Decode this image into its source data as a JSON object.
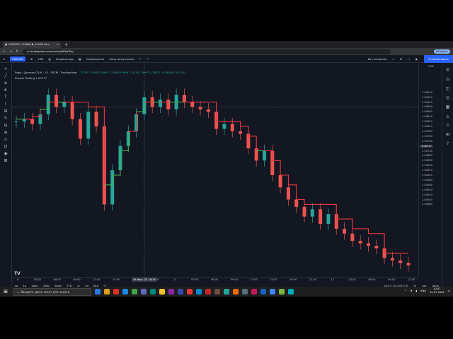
{
  "browser": {
    "tab_title": "EURUSD 1.00846 ▼ -0.56% Без...",
    "new_tab": "+",
    "url": "ru.tradingview.com/chart/pbE9oHPq/",
    "renew_label": "Обновить"
  },
  "tv_toolbar": {
    "symbol": "EURUSD",
    "timeframe": "15М",
    "indicators": "Индикаторы",
    "alerts": "Оповещения",
    "replay": "Симулятор рынка",
    "unnamed": "Без названия",
    "publish": "Опубликовать"
  },
  "legend": {
    "title": "Евро / Доллар США · 15 · FXCM · TradingView",
    "ohlc": "ОТКР 1.00822 МАКС 1.00859 МИН 1.00767 ЗАКР 1.00817 -0.00009 (-0.01%)",
    "indicator": "Simple Trading 1.00717"
  },
  "chart_data": {
    "type": "line",
    "title": "Евро / Доллар США · 15 · FXCM · TradingView",
    "ylim": [
      1.002,
      1.01
    ],
    "price_ticks": [
      "1.00940",
      "1.00920",
      "1.00900",
      "1.00880",
      "1.00860",
      "1.00840",
      "1.00820",
      "1.00800",
      "1.00780",
      "1.00760",
      "1.00740",
      "1.00720",
      "1.00700",
      "1.00680",
      "1.00660",
      "1.00640",
      "1.00620",
      "1.00600",
      "1.00580",
      "1.00560",
      "1.00540",
      "1.00520",
      "1.00500",
      "1.00480"
    ],
    "current_price": "1.00717",
    "currency": "USD",
    "time_ticks": [
      "8",
      "03:00",
      "06:00",
      "09:00",
      "12:00",
      "15:00",
      "18:00",
      "21:00",
      "11",
      "03:00",
      "06:00",
      "09:00",
      "12:00",
      "15:00",
      "18:00",
      "21:00",
      "12",
      "03:00",
      "06:00",
      "09:00",
      "12:00"
    ],
    "crosshair_time": "08 Июл '22   18:30",
    "series": [
      {
        "name": "Price",
        "values": [
          1.0082,
          1.0083,
          1.0081,
          1.0085,
          1.0093,
          1.0088,
          1.009,
          1.0083,
          1.0075,
          1.0086,
          1.008,
          1.0048,
          1.0062,
          1.0072,
          1.0078,
          1.0085,
          1.0092,
          1.0088,
          1.0091,
          1.0087,
          1.0093,
          1.009,
          1.0088,
          1.0087,
          1.0086,
          1.0079,
          1.0081,
          1.0078,
          1.0077,
          1.0071,
          1.0066,
          1.007,
          1.006,
          1.0055,
          1.005,
          1.0047,
          1.0043,
          1.0046,
          1.004,
          1.0044,
          1.0038,
          1.0036,
          1.0033,
          1.0032,
          1.0031,
          1.003,
          1.0026,
          1.0025,
          1.0024,
          1.0023
        ]
      },
      {
        "name": "Trend",
        "values": [
          1.0083,
          1.0083,
          1.0084,
          1.0087,
          1.009,
          1.009,
          1.009,
          1.009,
          1.009,
          1.0088,
          1.0088,
          1.0056,
          1.006,
          1.007,
          1.0078,
          1.0086,
          1.009,
          1.009,
          1.009,
          1.009,
          1.009,
          1.009,
          1.009,
          1.009,
          1.009,
          1.0082,
          1.0082,
          1.0082,
          1.008,
          1.0076,
          1.007,
          1.007,
          1.0066,
          1.006,
          1.0056,
          1.005,
          1.0048,
          1.0048,
          1.0048,
          1.0048,
          1.0042,
          1.0042,
          1.0038,
          1.0038,
          1.0036,
          1.0036,
          1.0028,
          1.0028,
          1.0028,
          1.0028
        ]
      }
    ],
    "colors": {
      "up": "#26a69a",
      "down": "#ef5350",
      "trend_up": "#4caf50",
      "trend_down": "#f23645",
      "bg": "#131722"
    }
  },
  "periods": {
    "items": [
      "1д",
      "5д",
      "1мес",
      "3мес",
      "6мес",
      "YTD",
      "1г",
      "5л",
      "Все"
    ],
    "time": "10:57:13 (UTC+3)",
    "pct": "%",
    "log": "лог",
    "auto": "авто"
  },
  "bottom_tabs": [
    "Скринер акций",
    "Редактор Pine",
    "Тестер стратегий",
    "Торговая панель"
  ],
  "taskbar": {
    "search_placeholder": "Введите здесь текст для поиска",
    "lang": "ENG",
    "time": "10:57",
    "date": "12.07.2022"
  }
}
